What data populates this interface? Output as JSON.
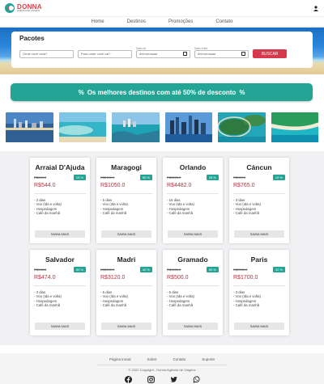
{
  "brand": {
    "name": "DONNA",
    "subtitle": "AGÊNCIA DE VIAGENS",
    "accent": "#23a595",
    "price_color": "#c9283a"
  },
  "nav": [
    {
      "label": "Home"
    },
    {
      "label": "Destinos"
    },
    {
      "label": "Promoções"
    },
    {
      "label": "Contato"
    }
  ],
  "search": {
    "title": "Pacotes",
    "origin_placeholder": "Onde você está?",
    "destination_placeholder": "Para onde você vai?",
    "departure_label": "Data de",
    "return_label": "Data Volta",
    "date_placeholder": "dd/mm/aaaa",
    "button": "BUSCAR"
  },
  "promo": {
    "icon": "%",
    "text": "Os melhores destinos com até 50% de desconto"
  },
  "packages": [
    {
      "name": "Arraial D'Ajuda",
      "old_price": "R$640.0",
      "discount": "15 %",
      "price": "R$544.0",
      "features": [
        "- 3 dias",
        "- Voo (Ida e volta)",
        "- Hospedagem",
        "- Café da manhã"
      ],
      "button": "SAIBA MAIS"
    },
    {
      "name": "Maragogi",
      "old_price": "R$2100.0",
      "discount": "50 %",
      "price": "R$1050.0",
      "features": [
        "- 5 dias",
        "- Voo (Ida e volta)",
        "- Hospedagem",
        "- Café da manhã"
      ],
      "button": "SAIBA MAIS"
    },
    {
      "name": "Orlando",
      "old_price": "R$6225.0",
      "discount": "28 %",
      "price": "R$4482.0",
      "features": [
        "- 16 dias",
        "- Voo (Ida e volta)",
        "- Hospedagem",
        "- Café da manhã"
      ],
      "button": "SAIBA MAIS"
    },
    {
      "name": "Cáncun",
      "old_price": "R$900.0",
      "discount": "15 %",
      "price": "R$765.0",
      "features": [
        "- 3 dias",
        "- Voo (Ida e volta)",
        "- Hospedagem",
        "- Café da manhã"
      ],
      "button": "SAIBA MAIS"
    },
    {
      "name": "Salvador",
      "old_price": "R$948.0",
      "discount": "50 %",
      "price": "R$474.0",
      "features": [
        "- 3 dias",
        "- Voo (Ida e volta)",
        "- Hospedagem",
        "- Café da manhã"
      ],
      "button": "SAIBA MAIS"
    },
    {
      "name": "Madri",
      "old_price": "R$5200.0",
      "discount": "40 %",
      "price": "R$3120.0",
      "features": [
        "- 5 dias",
        "- Voo (Ida e volta)",
        "- Hospedagem",
        "- Café da manhã"
      ],
      "button": "SAIBA MAIS"
    },
    {
      "name": "Gramado",
      "old_price": "R$1000.0",
      "discount": "50 %",
      "price": "R$500.0",
      "features": [
        "- 6 dias",
        "- Voo (Ida e volta)",
        "- Hospedagem",
        "- Café da manhã"
      ],
      "button": "SAIBA MAIS"
    },
    {
      "name": "Paris",
      "old_price": "R$2500.0",
      "discount": "32 %",
      "price": "R$1700.0",
      "features": [
        "- 3 dias",
        "- Voo (Ida e volta)",
        "- Hospedagem",
        "- Café da manhã"
      ],
      "button": "SAIBA MAIS"
    }
  ],
  "footer": {
    "links": [
      {
        "label": "Página inicial"
      },
      {
        "label": "Sobre"
      },
      {
        "label": "Contato"
      },
      {
        "label": "Suporte"
      }
    ],
    "copyright": "© 2022 Copyright - Donna Agência de Viagens",
    "socials": [
      "facebook-icon",
      "instagram-icon",
      "twitter-icon",
      "whatsapp-icon"
    ]
  }
}
